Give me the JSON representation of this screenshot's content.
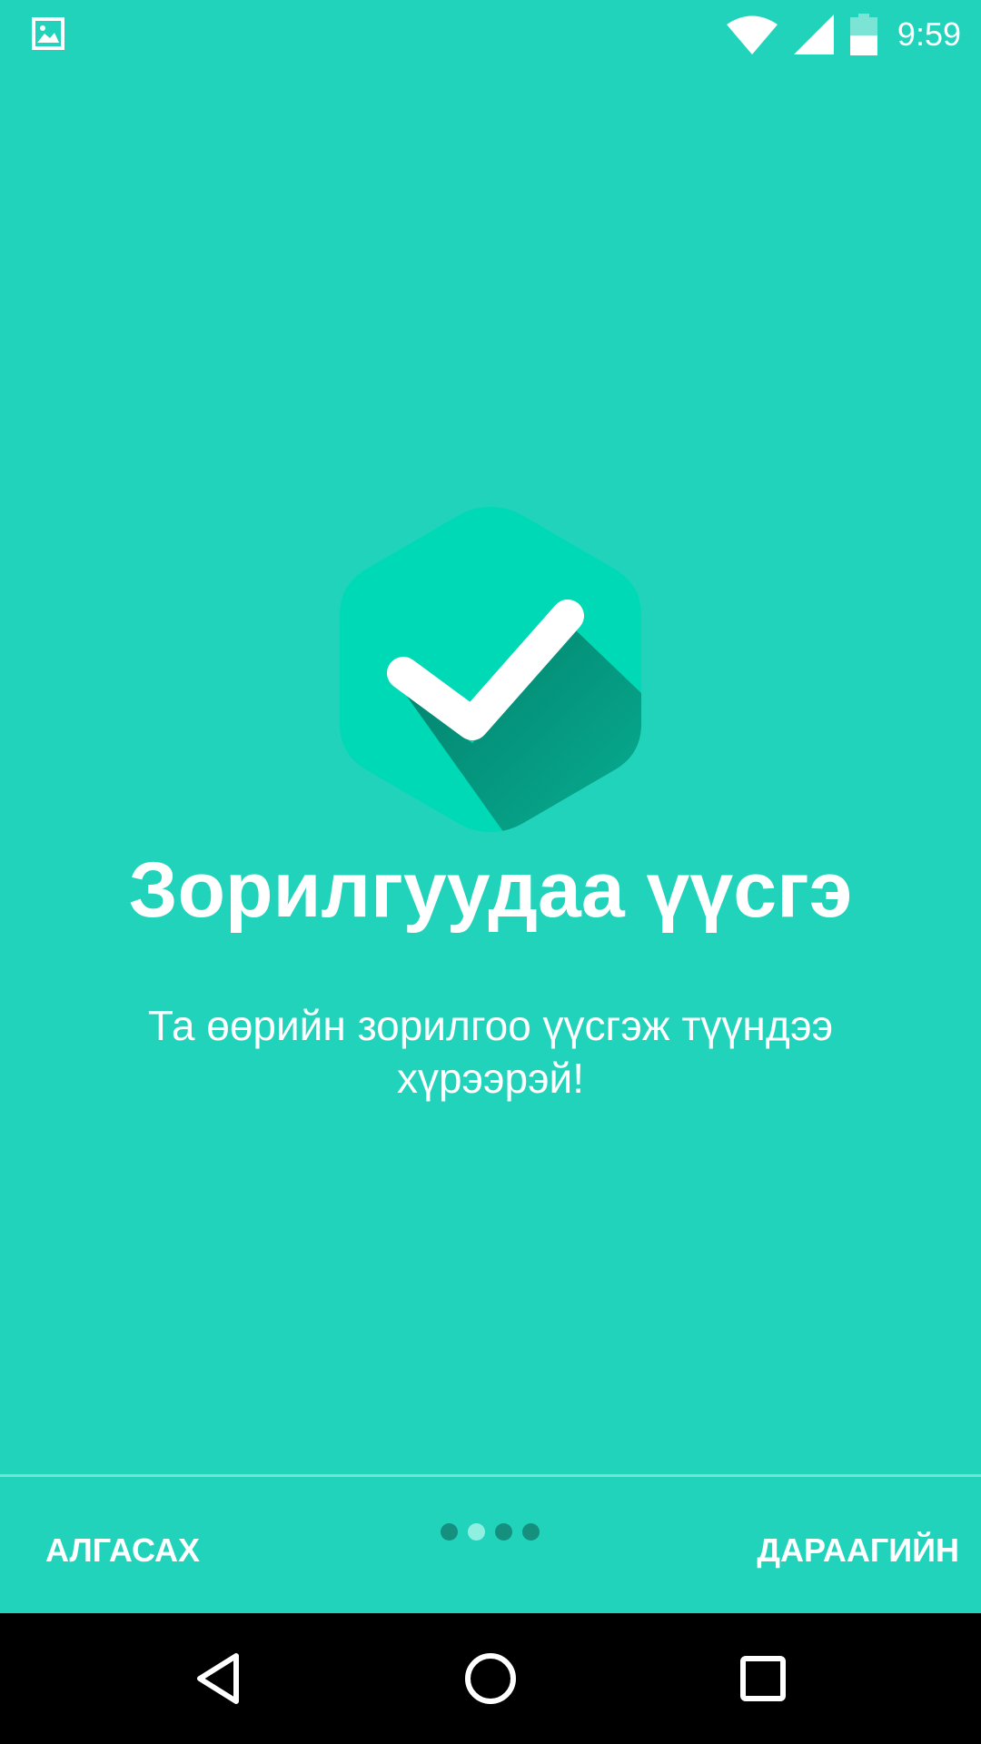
{
  "status_bar": {
    "time": "9:59",
    "icons": [
      "gallery-icon",
      "wifi-icon",
      "cell-signal-icon",
      "battery-icon"
    ]
  },
  "onboarding": {
    "hero_icon": "checkmark-hexagon-icon",
    "title": "Зорилгуудаа үүсгэ",
    "subtitle": "Та өөрийн зорилгоо үүсгэж түүндээ хүрээрэй!",
    "page_indicator": {
      "total": 4,
      "current": 2
    }
  },
  "bottom_bar": {
    "skip_label": "АЛГАСАХ",
    "next_label": "ДАРААГИЙН"
  },
  "nav_bar": {
    "icons": [
      "back-icon",
      "home-icon",
      "recents-icon"
    ]
  },
  "colors": {
    "background": "#22d3bc",
    "hexagon": "#00d9b5",
    "shadow": "#058570",
    "divider": "#74e3d4",
    "dot_inactive": "#15907f",
    "dot_active": "#8ff0e2"
  }
}
